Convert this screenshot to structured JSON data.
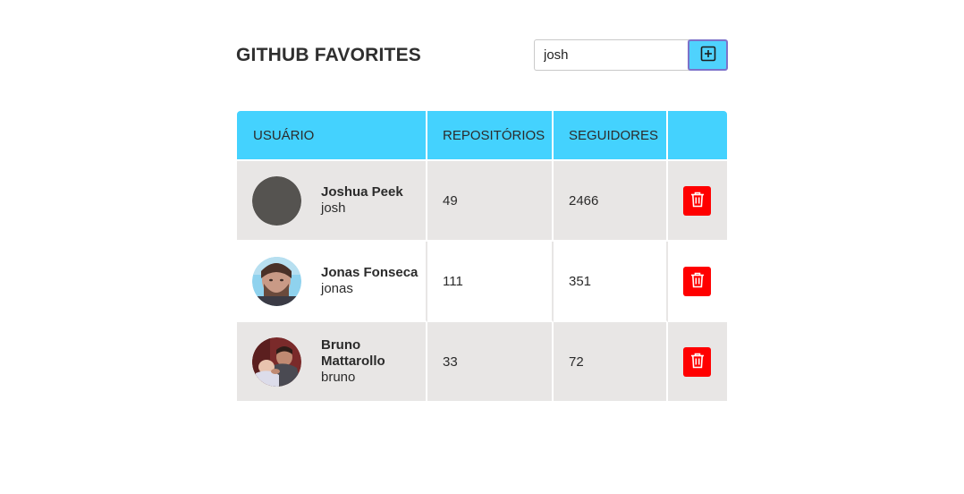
{
  "header": {
    "title": "GITHUB FAVORITES",
    "search": {
      "value": "josh",
      "placeholder": ""
    },
    "add_button_icon": "plus-square-icon"
  },
  "table": {
    "columns": [
      "USUÁRIO",
      "REPOSITÓRIOS",
      "SEGUIDORES",
      ""
    ],
    "rows": [
      {
        "name": "Joshua Peek",
        "login": "josh",
        "repositories": "49",
        "followers": "2466",
        "avatar": "gray-placeholder-avatar"
      },
      {
        "name": "Jonas Fonseca",
        "login": "jonas",
        "repositories": "111",
        "followers": "351",
        "avatar": "photo-avatar-man-with-beard"
      },
      {
        "name": "Bruno Mattarollo",
        "login": "bruno",
        "repositories": "33",
        "followers": "72",
        "avatar": "photo-avatar-man-with-baby"
      }
    ],
    "delete_icon": "trash-icon"
  },
  "colors": {
    "header_accent": "#44d2fe",
    "row_background": "#e8e6e5",
    "delete_button": "#ff0000",
    "add_button_border": "#7d72c9"
  }
}
